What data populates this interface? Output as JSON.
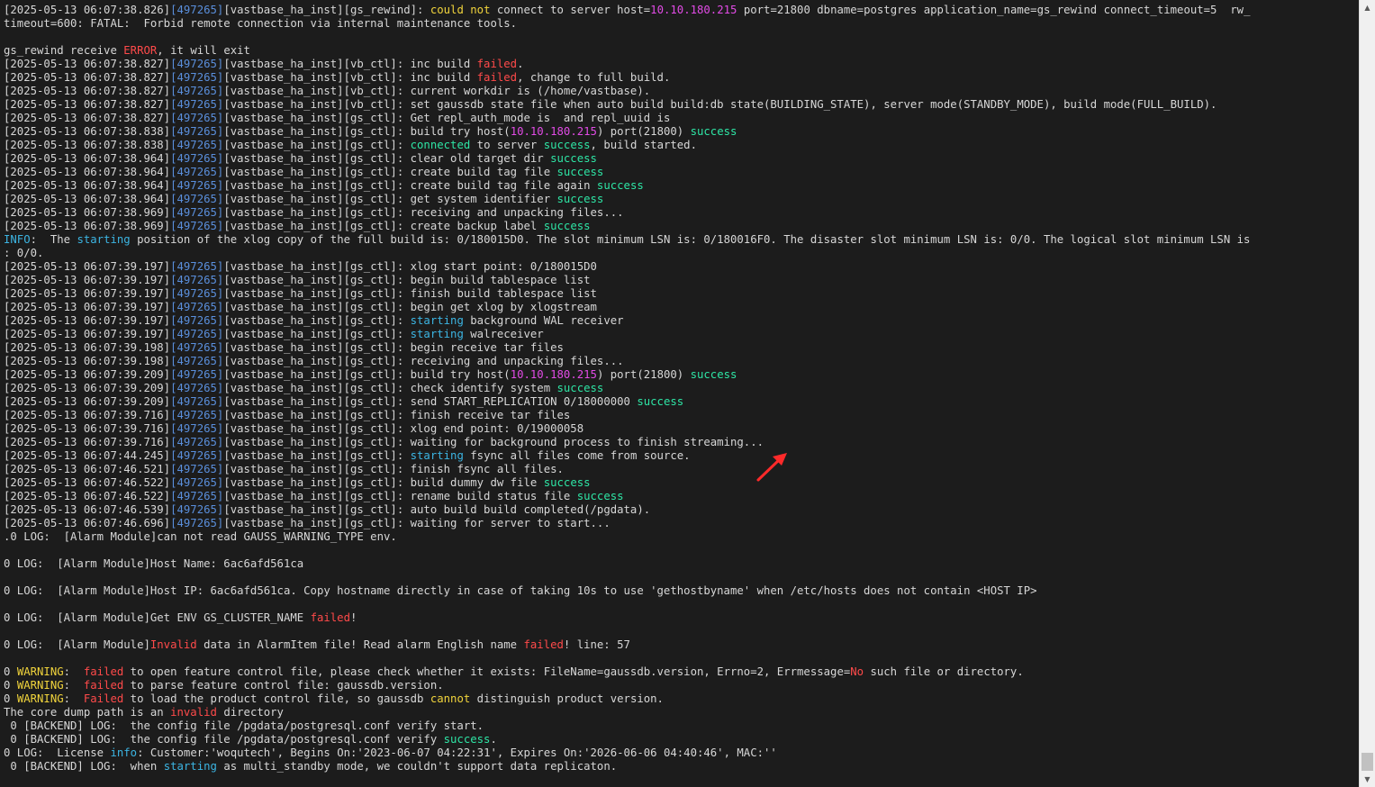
{
  "terminal": {
    "colors": {
      "background": "#1c1c1c",
      "text": "#d7d7d7",
      "pid": "#5a8fdc",
      "error": "#ff4a4a",
      "success": "#2ee5a5",
      "info": "#3cb5e3",
      "warning": "#f1d43c",
      "host": "#e24be6",
      "annotation_arrow": "#ff2a2a"
    },
    "lines": [
      [
        [
          "[2025-05-13 06:07:38.826]",
          ""
        ],
        [
          "[497265]",
          "pid"
        ],
        [
          "[vastbase_ha_inst][gs_rewind]: ",
          ""
        ],
        [
          "could not",
          "yellow"
        ],
        [
          " connect to server host=",
          ""
        ],
        [
          "10.10.180.215",
          "magenta"
        ],
        [
          " port=21800 dbname=postgres application_name=gs_rewind connect_timeout=5  rw_",
          ""
        ]
      ],
      [
        [
          "timeout=600: FATAL:  Forbid remote connection via internal maintenance tools.",
          ""
        ]
      ],
      [
        [
          "",
          ""
        ]
      ],
      [
        [
          "gs_rewind receive ",
          ""
        ],
        [
          "ERROR",
          "red"
        ],
        [
          ", it will exit",
          ""
        ]
      ],
      [
        [
          "[2025-05-13 06:07:38.827]",
          ""
        ],
        [
          "[497265]",
          "pid"
        ],
        [
          "[vastbase_ha_inst][vb_ctl]: inc build ",
          ""
        ],
        [
          "failed",
          "red"
        ],
        [
          ".",
          ""
        ]
      ],
      [
        [
          "[2025-05-13 06:07:38.827]",
          ""
        ],
        [
          "[497265]",
          "pid"
        ],
        [
          "[vastbase_ha_inst][vb_ctl]: inc build ",
          ""
        ],
        [
          "failed",
          "red"
        ],
        [
          ", change to full build.",
          ""
        ]
      ],
      [
        [
          "[2025-05-13 06:07:38.827]",
          ""
        ],
        [
          "[497265]",
          "pid"
        ],
        [
          "[vastbase_ha_inst][vb_ctl]: current workdir is (/home/vastbase).",
          ""
        ]
      ],
      [
        [
          "[2025-05-13 06:07:38.827]",
          ""
        ],
        [
          "[497265]",
          "pid"
        ],
        [
          "[vastbase_ha_inst][vb_ctl]: set gaussdb state file when auto build build:db state(BUILDING_STATE), server mode(STANDBY_MODE), build mode(FULL_BUILD).",
          ""
        ]
      ],
      [
        [
          "[2025-05-13 06:07:38.827]",
          ""
        ],
        [
          "[497265]",
          "pid"
        ],
        [
          "[vastbase_ha_inst][gs_ctl]: Get repl_auth_mode is  and repl_uuid is",
          ""
        ]
      ],
      [
        [
          "[2025-05-13 06:07:38.838]",
          ""
        ],
        [
          "[497265]",
          "pid"
        ],
        [
          "[vastbase_ha_inst][gs_ctl]: build try host(",
          ""
        ],
        [
          "10.10.180.215",
          "magenta"
        ],
        [
          ") port(21800) ",
          ""
        ],
        [
          "success",
          "green"
        ]
      ],
      [
        [
          "[2025-05-13 06:07:38.838]",
          ""
        ],
        [
          "[497265]",
          "pid"
        ],
        [
          "[vastbase_ha_inst][gs_ctl]: ",
          ""
        ],
        [
          "connected",
          "green"
        ],
        [
          " to server ",
          ""
        ],
        [
          "success",
          "green"
        ],
        [
          ", build started.",
          ""
        ]
      ],
      [
        [
          "[2025-05-13 06:07:38.964]",
          ""
        ],
        [
          "[497265]",
          "pid"
        ],
        [
          "[vastbase_ha_inst][gs_ctl]: clear old target dir ",
          ""
        ],
        [
          "success",
          "green"
        ]
      ],
      [
        [
          "[2025-05-13 06:07:38.964]",
          ""
        ],
        [
          "[497265]",
          "pid"
        ],
        [
          "[vastbase_ha_inst][gs_ctl]: create build tag file ",
          ""
        ],
        [
          "success",
          "green"
        ]
      ],
      [
        [
          "[2025-05-13 06:07:38.964]",
          ""
        ],
        [
          "[497265]",
          "pid"
        ],
        [
          "[vastbase_ha_inst][gs_ctl]: create build tag file again ",
          ""
        ],
        [
          "success",
          "green"
        ]
      ],
      [
        [
          "[2025-05-13 06:07:38.964]",
          ""
        ],
        [
          "[497265]",
          "pid"
        ],
        [
          "[vastbase_ha_inst][gs_ctl]: get system identifier ",
          ""
        ],
        [
          "success",
          "green"
        ]
      ],
      [
        [
          "[2025-05-13 06:07:38.969]",
          ""
        ],
        [
          "[497265]",
          "pid"
        ],
        [
          "[vastbase_ha_inst][gs_ctl]: receiving and unpacking files...",
          ""
        ]
      ],
      [
        [
          "[2025-05-13 06:07:38.969]",
          ""
        ],
        [
          "[497265]",
          "pid"
        ],
        [
          "[vastbase_ha_inst][gs_ctl]: create backup label ",
          ""
        ],
        [
          "success",
          "green"
        ]
      ],
      [
        [
          "INFO",
          "cyan"
        ],
        [
          ":  The ",
          ""
        ],
        [
          "starting",
          "cyan"
        ],
        [
          " position of the xlog copy of the full build is: 0/180015D0. The slot minimum LSN is: 0/180016F0. The disaster slot minimum LSN is: 0/0. The logical slot minimum LSN is",
          ""
        ]
      ],
      [
        [
          ": 0/0.",
          ""
        ]
      ],
      [
        [
          "[2025-05-13 06:07:39.197]",
          ""
        ],
        [
          "[497265]",
          "pid"
        ],
        [
          "[vastbase_ha_inst][gs_ctl]: xlog start point: 0/180015D0",
          ""
        ]
      ],
      [
        [
          "[2025-05-13 06:07:39.197]",
          ""
        ],
        [
          "[497265]",
          "pid"
        ],
        [
          "[vastbase_ha_inst][gs_ctl]: begin build tablespace list",
          ""
        ]
      ],
      [
        [
          "[2025-05-13 06:07:39.197]",
          ""
        ],
        [
          "[497265]",
          "pid"
        ],
        [
          "[vastbase_ha_inst][gs_ctl]: finish build tablespace list",
          ""
        ]
      ],
      [
        [
          "[2025-05-13 06:07:39.197]",
          ""
        ],
        [
          "[497265]",
          "pid"
        ],
        [
          "[vastbase_ha_inst][gs_ctl]: begin get xlog by xlogstream",
          ""
        ]
      ],
      [
        [
          "[2025-05-13 06:07:39.197]",
          ""
        ],
        [
          "[497265]",
          "pid"
        ],
        [
          "[vastbase_ha_inst][gs_ctl]: ",
          ""
        ],
        [
          "starting",
          "cyan"
        ],
        [
          " background WAL receiver",
          ""
        ]
      ],
      [
        [
          "[2025-05-13 06:07:39.197]",
          ""
        ],
        [
          "[497265]",
          "pid"
        ],
        [
          "[vastbase_ha_inst][gs_ctl]: ",
          ""
        ],
        [
          "starting",
          "cyan"
        ],
        [
          " walreceiver",
          ""
        ]
      ],
      [
        [
          "[2025-05-13 06:07:39.198]",
          ""
        ],
        [
          "[497265]",
          "pid"
        ],
        [
          "[vastbase_ha_inst][gs_ctl]: begin receive tar files",
          ""
        ]
      ],
      [
        [
          "[2025-05-13 06:07:39.198]",
          ""
        ],
        [
          "[497265]",
          "pid"
        ],
        [
          "[vastbase_ha_inst][gs_ctl]: receiving and unpacking files...",
          ""
        ]
      ],
      [
        [
          "[2025-05-13 06:07:39.209]",
          ""
        ],
        [
          "[497265]",
          "pid"
        ],
        [
          "[vastbase_ha_inst][gs_ctl]: build try host(",
          ""
        ],
        [
          "10.10.180.215",
          "magenta"
        ],
        [
          ") port(21800) ",
          ""
        ],
        [
          "success",
          "green"
        ]
      ],
      [
        [
          "[2025-05-13 06:07:39.209]",
          ""
        ],
        [
          "[497265]",
          "pid"
        ],
        [
          "[vastbase_ha_inst][gs_ctl]: check identify system ",
          ""
        ],
        [
          "success",
          "green"
        ]
      ],
      [
        [
          "[2025-05-13 06:07:39.209]",
          ""
        ],
        [
          "[497265]",
          "pid"
        ],
        [
          "[vastbase_ha_inst][gs_ctl]: send START_REPLICATION 0/18000000 ",
          ""
        ],
        [
          "success",
          "green"
        ]
      ],
      [
        [
          "[2025-05-13 06:07:39.716]",
          ""
        ],
        [
          "[497265]",
          "pid"
        ],
        [
          "[vastbase_ha_inst][gs_ctl]: finish receive tar files",
          ""
        ]
      ],
      [
        [
          "[2025-05-13 06:07:39.716]",
          ""
        ],
        [
          "[497265]",
          "pid"
        ],
        [
          "[vastbase_ha_inst][gs_ctl]: xlog end point: 0/19000058",
          ""
        ]
      ],
      [
        [
          "[2025-05-13 06:07:39.716]",
          ""
        ],
        [
          "[497265]",
          "pid"
        ],
        [
          "[vastbase_ha_inst][gs_ctl]: waiting for background process to finish streaming...",
          ""
        ]
      ],
      [
        [
          "[2025-05-13 06:07:44.245]",
          ""
        ],
        [
          "[497265]",
          "pid"
        ],
        [
          "[vastbase_ha_inst][gs_ctl]: ",
          ""
        ],
        [
          "starting",
          "cyan"
        ],
        [
          " fsync all files come from source.",
          ""
        ]
      ],
      [
        [
          "[2025-05-13 06:07:46.521]",
          ""
        ],
        [
          "[497265]",
          "pid"
        ],
        [
          "[vastbase_ha_inst][gs_ctl]: finish fsync all files.",
          ""
        ]
      ],
      [
        [
          "[2025-05-13 06:07:46.522]",
          ""
        ],
        [
          "[497265]",
          "pid"
        ],
        [
          "[vastbase_ha_inst][gs_ctl]: build dummy dw file ",
          ""
        ],
        [
          "success",
          "green"
        ]
      ],
      [
        [
          "[2025-05-13 06:07:46.522]",
          ""
        ],
        [
          "[497265]",
          "pid"
        ],
        [
          "[vastbase_ha_inst][gs_ctl]: rename build status file ",
          ""
        ],
        [
          "success",
          "green"
        ]
      ],
      [
        [
          "[2025-05-13 06:07:46.539]",
          ""
        ],
        [
          "[497265]",
          "pid"
        ],
        [
          "[vastbase_ha_inst][gs_ctl]: auto build build completed(/pgdata).",
          ""
        ]
      ],
      [
        [
          "[2025-05-13 06:07:46.696]",
          ""
        ],
        [
          "[497265]",
          "pid"
        ],
        [
          "[vastbase_ha_inst][gs_ctl]: waiting for server to start...",
          ""
        ]
      ],
      [
        [
          ".0 LOG:  [Alarm Module]can not read GAUSS_WARNING_TYPE env.",
          ""
        ]
      ],
      [
        [
          "",
          ""
        ]
      ],
      [
        [
          "0 LOG:  [Alarm Module]Host Name: 6ac6afd561ca",
          ""
        ]
      ],
      [
        [
          "",
          ""
        ]
      ],
      [
        [
          "0 LOG:  [Alarm Module]Host IP: 6ac6afd561ca. Copy hostname directly in case of taking 10s to use 'gethostbyname' when /etc/hosts does not contain <HOST IP>",
          ""
        ]
      ],
      [
        [
          "",
          ""
        ]
      ],
      [
        [
          "0 LOG:  [Alarm Module]Get ENV GS_CLUSTER_NAME ",
          ""
        ],
        [
          "failed",
          "red"
        ],
        [
          "!",
          ""
        ]
      ],
      [
        [
          "",
          ""
        ]
      ],
      [
        [
          "0 LOG:  [Alarm Module]",
          ""
        ],
        [
          "Invalid",
          "red"
        ],
        [
          " data in AlarmItem file! Read alarm English name ",
          ""
        ],
        [
          "failed",
          "red"
        ],
        [
          "! line: 57",
          ""
        ]
      ],
      [
        [
          "",
          ""
        ]
      ],
      [
        [
          "0 ",
          ""
        ],
        [
          "WARNING",
          "yellow"
        ],
        [
          ":  ",
          ""
        ],
        [
          "failed",
          "red"
        ],
        [
          " to open feature control file, please check whether it exists: FileName=gaussdb.version, Errno=2, Errmessage=",
          ""
        ],
        [
          "No",
          "red"
        ],
        [
          " such file or directory.",
          ""
        ]
      ],
      [
        [
          "0 ",
          ""
        ],
        [
          "WARNING",
          "yellow"
        ],
        [
          ":  ",
          ""
        ],
        [
          "failed",
          "red"
        ],
        [
          " to parse feature control file: gaussdb.version.",
          ""
        ]
      ],
      [
        [
          "0 ",
          ""
        ],
        [
          "WARNING",
          "yellow"
        ],
        [
          ":  ",
          ""
        ],
        [
          "Failed",
          "red"
        ],
        [
          " to load the product control file, so gaussdb ",
          ""
        ],
        [
          "cannot",
          "yellow"
        ],
        [
          " distinguish product version.",
          ""
        ]
      ],
      [
        [
          "The core dump path is an ",
          ""
        ],
        [
          "invalid",
          "red"
        ],
        [
          " directory",
          ""
        ]
      ],
      [
        [
          " 0 [BACKEND] LOG:  the config file /pgdata/postgresql.conf verify start.",
          ""
        ]
      ],
      [
        [
          " 0 [BACKEND] LOG:  the config file /pgdata/postgresql.conf verify ",
          ""
        ],
        [
          "success",
          "green"
        ],
        [
          ".",
          ""
        ]
      ],
      [
        [
          "0 LOG:  License ",
          ""
        ],
        [
          "info",
          "cyan"
        ],
        [
          ": Customer:'woqutech', Begins On:'2023-06-07 04:22:31', Expires On:'2026-06-06 04:40:46', MAC:''",
          ""
        ]
      ],
      [
        [
          " 0 [BACKEND] LOG:  when ",
          ""
        ],
        [
          "starting",
          "cyan"
        ],
        [
          " as multi_standby mode, we couldn't support data replicaton.",
          ""
        ]
      ]
    ]
  },
  "scrollbar": {
    "up_icon": "triangle-up-icon",
    "down_icon": "triangle-down-icon",
    "up_glyph": "▲",
    "down_glyph": "▼",
    "position": 0.98
  },
  "annotation": {
    "icon": "red-arrow-icon"
  }
}
